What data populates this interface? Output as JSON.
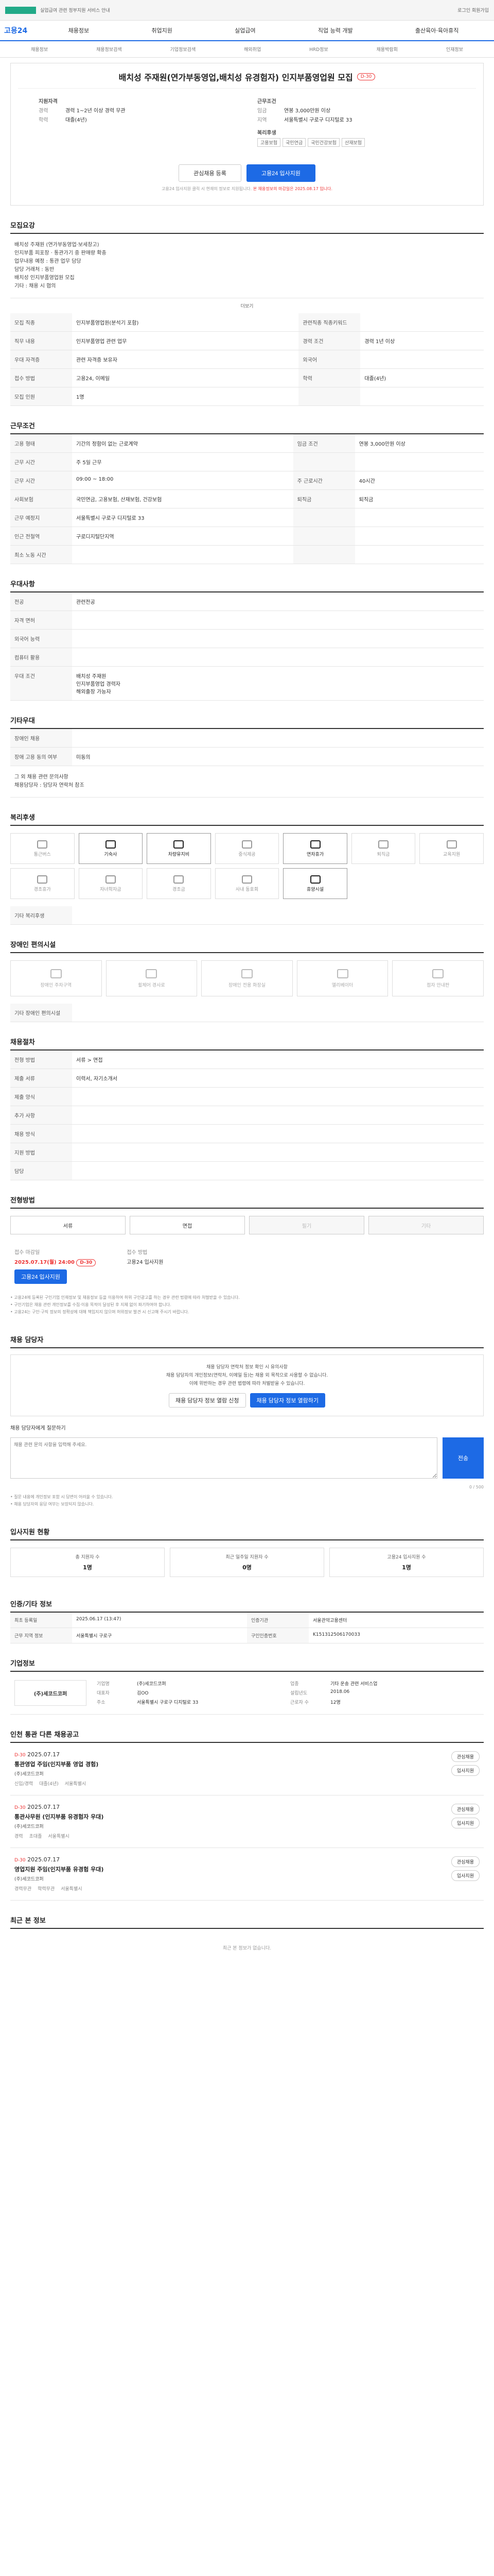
{
  "topbar": {
    "left_text": "실업급여 관련 정부지원 서비스 안내",
    "right_text": "로그인 회원가입"
  },
  "gnb": {
    "brand": "고용24",
    "menu": [
      "채용정보",
      "취업지원",
      "실업급여",
      "직업 능력 개발",
      "출산육아·육아휴직"
    ]
  },
  "subnav": [
    "채용정보",
    "채용정보검색",
    "기업정보검색",
    "해외취업",
    "HRD정보",
    "채용박람회",
    "인재정보"
  ],
  "title": {
    "text": "배치성 주재원(연가부동영업,배치성 유경험자) 인지부품영업원 모집",
    "dday": "D-30"
  },
  "summary": {
    "left_title": "지원자격",
    "left": [
      {
        "k": "경력",
        "v": "경력 1~2년 이상 경력 무관"
      },
      {
        "k": "학력",
        "v": "대졸(4년)"
      }
    ],
    "right_title": "근무조건",
    "right": [
      {
        "k": "임금",
        "v": "연봉 3,000만원 이상"
      },
      {
        "k": "지역",
        "v": "서울특별시 구로구 디지털로 33"
      }
    ],
    "welfare_title": "복리후생",
    "tags": [
      "고용보험",
      "국민연금",
      "국민건강보험",
      "산재보험"
    ]
  },
  "actions": {
    "scrap": "관심채용 등록",
    "apply": "고용24 입사지원"
  },
  "notice": {
    "text": "고용24 입사지원 클릭 시 현재의 정보로 지원됩니다.",
    "highlight": "본 채용정보의 마감일은 2025.08.17 입니다."
  },
  "sections": {
    "detail": "모집요강",
    "detail_text": "배치성 주재원 (연가부동영업·보세창고)\n인지부품 피포장 · 통관가기 중 판매량 확충\n업무내용 예정 : 통관 업무 담당\n담당 거래처 : 동반\n배치성 인지부품영업원 모집\n기타 : 채용 시 협의",
    "more": "더보기",
    "job_rows": [
      {
        "k": "모집 직종",
        "v": "인지부품영업원(분석기 포함)",
        "k2": "관련직종 직종키워드",
        "v2": ""
      },
      {
        "k": "직무 내용",
        "v": "인지부품영업 관련 업무",
        "k2": "경력 조건",
        "v2": "경력 1년 이상"
      },
      {
        "k": "우대 자격증",
        "v": "관련 자격증 보유자",
        "k2": "외국어",
        "v2": ""
      },
      {
        "k": "접수 방법",
        "v": "고용24, 이메일",
        "k2": "학력",
        "v2": "대졸(4년)"
      },
      {
        "k": "모집 인원",
        "v": "1명",
        "k2": "",
        "v2": ""
      }
    ],
    "work": "근무조건",
    "work_rows": [
      {
        "k": "고용 형태",
        "v": "기간의 정함이 없는 근로계약",
        "k2": "임금 조건",
        "v2": "연봉 3,000만원 이상"
      },
      {
        "k": "근무 시간",
        "v": "주 5일 근무",
        "k2": "",
        "v2": ""
      },
      {
        "k": "근무 시간",
        "v": "09:00 ~ 18:00",
        "k2": "주 근로시간",
        "v2": "40시간"
      },
      {
        "k": "사회보험",
        "v": "국민연금, 고용보험, 산재보험, 건강보험",
        "k2": "퇴직금",
        "v2": "퇴직금"
      },
      {
        "k": "근무 예정지",
        "v": "서울특별시 구로구 디지털로 33",
        "k2": "",
        "v2": ""
      },
      {
        "k": "인근 전철역",
        "v": "구로디지털단지역",
        "k2": "",
        "v2": ""
      },
      {
        "k": "최소 노동 시간",
        "v": "",
        "k2": "",
        "v2": ""
      }
    ],
    "prefer": "우대사항",
    "prefer_rows": [
      {
        "k": "전공",
        "v": "관련전공"
      },
      {
        "k": "자격 면허",
        "v": ""
      },
      {
        "k": "외국어 능력",
        "v": ""
      },
      {
        "k": "컴퓨터 활용",
        "v": ""
      },
      {
        "k": "우대 조건",
        "v": "배치성 주재원\n인지부품영업 경력자\n해외출장 가능자"
      }
    ],
    "other": "기타우대",
    "other_rows": [
      {
        "k": "장애인 채용",
        "v": ""
      },
      {
        "k": "장애 고용 동의 여부",
        "v": "미동의"
      }
    ],
    "other_text": "그 외 채용 관련 문의사항\n채용담당자 : 담당자 연락처 참조",
    "benefits": "복리후생",
    "benefit_items": [
      {
        "label": "통근버스",
        "on": false
      },
      {
        "label": "기숙사",
        "on": true
      },
      {
        "label": "차량유지비",
        "on": true
      },
      {
        "label": "중식제공",
        "on": false
      },
      {
        "label": "연차휴가",
        "on": true
      },
      {
        "label": "퇴직금",
        "on": false
      },
      {
        "label": "교육지원",
        "on": false
      },
      {
        "label": "경조휴가",
        "on": false
      },
      {
        "label": "자녀학자금",
        "on": false
      },
      {
        "label": "경조금",
        "on": false
      },
      {
        "label": "사내 동호회",
        "on": false
      },
      {
        "label": "휴양시설",
        "on": true
      }
    ],
    "benefit_extra": "기타 복리후생",
    "disability": "장애인 편의시설",
    "disab_items": [
      "장애인 주차구역",
      "휠체어 경사로",
      "장애인 전용 화장실",
      "엘리베이터",
      "점자 안내판"
    ],
    "disab_extra": "기타 장애인 편의시설",
    "recruit_proc": "채용절차",
    "recruit_rows": [
      {
        "k": "전형 방법",
        "v": "서류 > 면접"
      },
      {
        "k": "제출 서류",
        "v": "이력서, 자기소개서"
      },
      {
        "k": "제출 양식",
        "v": ""
      },
      {
        "k": "추가 사항",
        "v": ""
      }
    ],
    "recruit_rows2": [
      {
        "k": "채용 방식",
        "v": ""
      },
      {
        "k": "지원 방법",
        "v": ""
      },
      {
        "k": "담당",
        "v": ""
      }
    ],
    "method": "전형방법",
    "methods": [
      {
        "label": "서류",
        "dis": false
      },
      {
        "label": "면접",
        "dis": false
      },
      {
        "label": "필기",
        "dis": true
      },
      {
        "label": "기타",
        "dis": true
      }
    ],
    "period_lbl": "접수 마감일",
    "period_val": "2025.07.17(월) 24:00",
    "period_dday": "D-30",
    "method2_lbl": "접수 방법",
    "method2_val": "고용24 입사지원",
    "apply_btn": "고용24 입사지원",
    "small_notes": "• 고용24에 등록된 구인기업 인재정보 및 채용정보 등을 이용하여 허위 구인광고를 하는 경우 관련 법령에 따라 처벌받을 수 있습니다.\n• 구인기업은 채용 관련 개인정보를 수집·이용 목적이 달성된 후 지체 없이 파기하여야 합니다.\n• 고용24는 구인·구직 정보의 정확성에 대해 책임지지 않으며 허위정보 발견 시 신고해 주시기 바랍니다.",
    "contact": "채용 담당자",
    "contact_text": "채용 담당자 연락처 정보 확인 시 유의사항\n채용 담당자의 개인정보(연락처, 이메일 등)는 채용 외 목적으로 사용할 수 없습니다.\n이에 위반하는 경우 관련 법령에 따라 처벌받을 수 있습니다.",
    "contact_btn1": "채용 담당자 정보 열람 신청",
    "contact_btn2": "채용 담당자 정보 열람하기",
    "qa_title": "채용 담당자에게 질문하기",
    "qa_placeholder": "채용 관련 문의 사항을 입력해 주세요.",
    "qa_send": "전송",
    "qa_count": "0 / 500",
    "qa_notes": "• 질문 내용에 개인정보 포함 시 답변이 어려울 수 있습니다.\n• 채용 담당자의 응답 여부는 보장되지 않습니다.",
    "stats": "입사지원 현황",
    "stat_items": [
      {
        "label": "총 지원자 수",
        "n": "1명"
      },
      {
        "label": "최근 일주일 지원자 수",
        "n": "0명"
      },
      {
        "label": "고용24 입사지원 수",
        "n": "1명"
      }
    ],
    "basic": "인증/기타 정보",
    "basic_rows": [
      {
        "k": "최초 등록일",
        "v": "2025.06.17 (13:47)",
        "k2": "인증기관",
        "v2": "서울관악고용센터"
      },
      {
        "k": "근무 지역 정보",
        "v": "서울특별시 구로구",
        "k2": "구인인증번호",
        "v2": "K151312506170033"
      }
    ],
    "company": "기업정보",
    "company_logo": "(주)세코드코퍼",
    "company_info": [
      {
        "k": "기업명",
        "v": "(주)세코드코퍼"
      },
      {
        "k": "업종",
        "v": "기타 운송 관련 서비스업"
      },
      {
        "k": "대표자",
        "v": "김OO"
      },
      {
        "k": "설립년도",
        "v": "2018.06"
      },
      {
        "k": "주소",
        "v": "서울특별시 구로구 디지털로 33"
      },
      {
        "k": "근로자 수",
        "v": "12명"
      }
    ],
    "other_jobs": "인천 통관 다른 채용공고",
    "jobs": [
      {
        "badge": "D-30",
        "date": "2025.07.17",
        "title": "통관영업 주임(인지부품 영업 경험)",
        "company": "(주)세코드코퍼",
        "meta": [
          "신입/경력",
          "대졸(4년)",
          "서울특별시"
        ]
      },
      {
        "badge": "D-30",
        "date": "2025.07.17",
        "title": "통관사무원 (인지부품 유경험자 우대)",
        "company": "(주)세코드코퍼",
        "meta": [
          "경력",
          "초대졸",
          "서울특별시"
        ]
      },
      {
        "badge": "D-30",
        "date": "2025.07.17",
        "title": "영업지원 주임(인지부품 유경험 우대)",
        "company": "(주)세코드코퍼",
        "meta": [
          "경력무관",
          "학력무관",
          "서울특별시"
        ]
      }
    ],
    "job_actions": [
      "관심채용",
      "입사지원"
    ],
    "recent": "최근 본 정보",
    "recent_empty": "최근 본 정보가 없습니다."
  }
}
